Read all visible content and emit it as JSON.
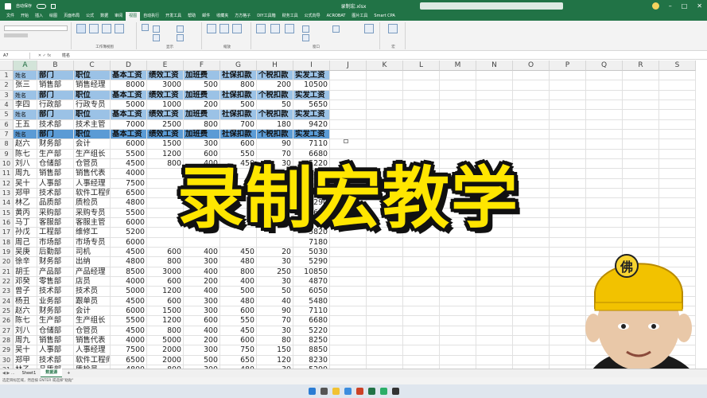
{
  "titlebar": {
    "autosave_label": "自动保存",
    "file_title": "录制宏.xlsx",
    "min": "–",
    "max": "□",
    "close": "✕"
  },
  "menu": [
    "文件",
    "开始",
    "插入",
    "绘图",
    "页面布局",
    "公式",
    "数据",
    "审阅",
    "视图",
    "自动执行",
    "开发工具",
    "帮助",
    "邮件",
    "收藏夹",
    "方方格子",
    "DIY工具箱",
    "财务工具",
    "公式向导",
    "ACROBAT",
    "图片工具",
    "Smart CPA"
  ],
  "menu_active_index": 8,
  "ribbon_groups": [
    "工作簿视图",
    "显示",
    "缩放",
    "窗口",
    "宏"
  ],
  "formula": {
    "name_box": "A7",
    "fx": "✕ ✓ fx",
    "content": "姓名"
  },
  "columns": [
    "A",
    "B",
    "C",
    "D",
    "E",
    "F",
    "G",
    "H",
    "I",
    "J",
    "K",
    "L",
    "M",
    "N",
    "O",
    "P",
    "Q",
    "R",
    "S"
  ],
  "selected_column": "A",
  "header_labels": [
    "姓名",
    "部门",
    "职位",
    "基本工资",
    "绩效工资",
    "加班费",
    "社保扣款",
    "个税扣款",
    "实发工资"
  ],
  "rows": [
    {
      "n": "1",
      "hdr": true,
      "v": [
        "姓名",
        "部门",
        "职位",
        "基本工资",
        "绩效工资",
        "加班费",
        "社保扣款",
        "个税扣款",
        "实发工资"
      ]
    },
    {
      "n": "2",
      "v": [
        "张三",
        "销售部",
        "销售经理",
        "8000",
        "3000",
        "500",
        "800",
        "200",
        "10500"
      ]
    },
    {
      "n": "3",
      "hdr": true,
      "v": [
        "姓名",
        "部门",
        "职位",
        "基本工资",
        "绩效工资",
        "加班费",
        "社保扣款",
        "个税扣款",
        "实发工资"
      ]
    },
    {
      "n": "4",
      "v": [
        "李四",
        "行政部",
        "行政专员",
        "5000",
        "1000",
        "200",
        "500",
        "50",
        "5650"
      ]
    },
    {
      "n": "5",
      "hdr": true,
      "v": [
        "姓名",
        "部门",
        "职位",
        "基本工资",
        "绩效工资",
        "加班费",
        "社保扣款",
        "个税扣款",
        "实发工资"
      ]
    },
    {
      "n": "6",
      "v": [
        "王五",
        "技术部",
        "技术主管",
        "7000",
        "2500",
        "800",
        "700",
        "180",
        "9420"
      ]
    },
    {
      "n": "7",
      "hdr": true,
      "dark": true,
      "v": [
        "姓名",
        "部门",
        "职位",
        "基本工资",
        "绩效工资",
        "加班费",
        "社保扣款",
        "个税扣款",
        "实发工资"
      ]
    },
    {
      "n": "8",
      "v": [
        "赵六",
        "财务部",
        "会计",
        "6000",
        "1500",
        "300",
        "600",
        "90",
        "7110"
      ]
    },
    {
      "n": "9",
      "v": [
        "陈七",
        "生产部",
        "生产组长",
        "5500",
        "1200",
        "600",
        "550",
        "70",
        "6680"
      ]
    },
    {
      "n": "10",
      "v": [
        "刘八",
        "仓储部",
        "仓管员",
        "4500",
        "800",
        "400",
        "450",
        "30",
        "5220"
      ]
    },
    {
      "n": "11",
      "v": [
        "周九",
        "销售部",
        "销售代表",
        "4000",
        "",
        "",
        "",
        "",
        "8250"
      ]
    },
    {
      "n": "12",
      "v": [
        "吴十",
        "人事部",
        "人事经理",
        "7500",
        "",
        "",
        "",
        "",
        "8850"
      ]
    },
    {
      "n": "13",
      "v": [
        "郑甲",
        "技术部",
        "软件工程师",
        "6500",
        "",
        "",
        "",
        "",
        "8230"
      ]
    },
    {
      "n": "14",
      "v": [
        "林乙",
        "品质部",
        "质检员",
        "4800",
        "",
        "",
        "",
        "",
        "5290"
      ]
    },
    {
      "n": "15",
      "v": [
        "黄丙",
        "采购部",
        "采购专员",
        "5500",
        "",
        "",
        "",
        "",
        "6610"
      ]
    },
    {
      "n": "16",
      "v": [
        "马丁",
        "客服部",
        "客服主管",
        "6000",
        "",
        "",
        "",
        "",
        "6810"
      ]
    },
    {
      "n": "17",
      "v": [
        "孙戊",
        "工程部",
        "维修工",
        "5200",
        "",
        "",
        "",
        "",
        "5820"
      ]
    },
    {
      "n": "18",
      "v": [
        "周己",
        "市场部",
        "市场专员",
        "6000",
        "",
        "",
        "",
        "",
        "7180"
      ]
    },
    {
      "n": "19",
      "v": [
        "吴庚",
        "后勤部",
        "司机",
        "4500",
        "600",
        "400",
        "450",
        "20",
        "5030"
      ]
    },
    {
      "n": "20",
      "v": [
        "徐辛",
        "财务部",
        "出纳",
        "4800",
        "800",
        "300",
        "480",
        "30",
        "5290"
      ]
    },
    {
      "n": "21",
      "v": [
        "胡壬",
        "产品部",
        "产品经理",
        "8500",
        "3000",
        "400",
        "800",
        "250",
        "10850"
      ]
    },
    {
      "n": "22",
      "v": [
        "邓癸",
        "零售部",
        "店员",
        "4000",
        "600",
        "200",
        "400",
        "30",
        "4870"
      ]
    },
    {
      "n": "23",
      "v": [
        "曾子",
        "技术部",
        "技术员",
        "5000",
        "1200",
        "400",
        "500",
        "50",
        "6050"
      ]
    },
    {
      "n": "24",
      "v": [
        "杨丑",
        "业务部",
        "跟单员",
        "4500",
        "600",
        "300",
        "480",
        "40",
        "5480"
      ]
    },
    {
      "n": "25",
      "v": [
        "赵六",
        "财务部",
        "会计",
        "6000",
        "1500",
        "300",
        "600",
        "90",
        "7110"
      ]
    },
    {
      "n": "26",
      "v": [
        "陈七",
        "生产部",
        "生产组长",
        "5500",
        "1200",
        "600",
        "550",
        "70",
        "6680"
      ]
    },
    {
      "n": "27",
      "v": [
        "刘八",
        "仓储部",
        "仓管员",
        "4500",
        "800",
        "400",
        "450",
        "30",
        "5220"
      ]
    },
    {
      "n": "28",
      "v": [
        "周九",
        "销售部",
        "销售代表",
        "4000",
        "5000",
        "200",
        "600",
        "80",
        "8250"
      ]
    },
    {
      "n": "29",
      "v": [
        "吴十",
        "人事部",
        "人事经理",
        "7500",
        "2000",
        "300",
        "750",
        "150",
        "8850"
      ]
    },
    {
      "n": "30",
      "v": [
        "郑甲",
        "技术部",
        "软件工程师",
        "6500",
        "2000",
        "500",
        "650",
        "120",
        "8230"
      ]
    },
    {
      "n": "31",
      "v": [
        "林乙",
        "品质部",
        "质检员",
        "4800",
        "800",
        "300",
        "480",
        "30",
        "5290"
      ]
    }
  ],
  "overlay": {
    "text": "录制宏教学"
  },
  "sheets": {
    "nav": "◀ ▶ ...",
    "tab1": "Sheet1",
    "tab2": "数据源",
    "add": "+"
  },
  "status": {
    "text": "选定目标区域，然后按 ENTER 或选择\"粘贴\""
  },
  "colors": {
    "excel_green": "#217346",
    "header_fill": "#9bc2e6",
    "header_dark": "#5b9bd5",
    "overlay_yellow": "#ffe600"
  }
}
